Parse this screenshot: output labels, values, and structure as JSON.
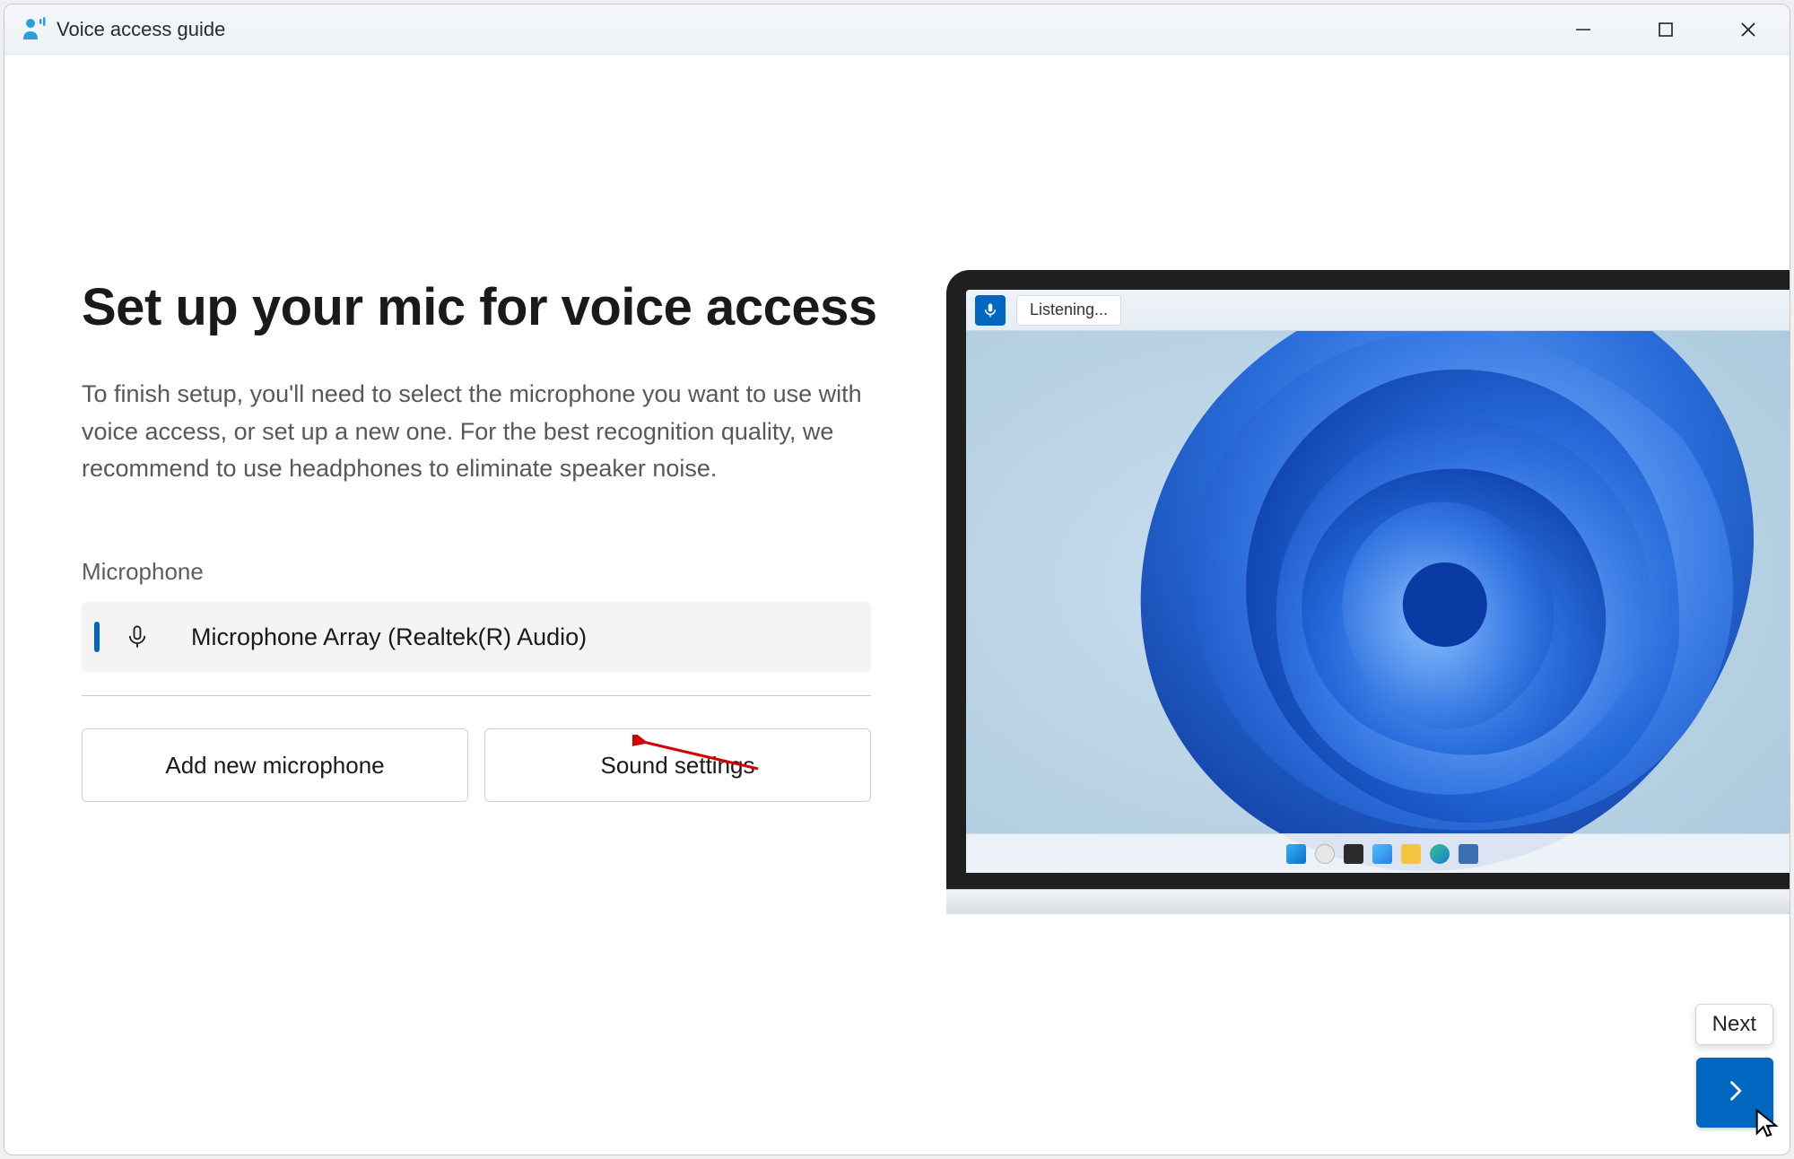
{
  "window": {
    "title": "Voice access guide"
  },
  "page": {
    "heading": "Set up your mic for voice access",
    "description": "To finish setup, you'll need to select the microphone you want to use with voice access, or set up a new one. For the best recognition quality, we recommend to use headphones to eliminate speaker noise.",
    "mic_section_label": "Microphone",
    "selected_mic": "Microphone Array (Realtek(R) Audio)",
    "buttons": {
      "add": "Add new microphone",
      "sound": "Sound settings"
    }
  },
  "preview": {
    "toolbar_status": "Listening..."
  },
  "footer": {
    "next_tooltip": "Next"
  }
}
